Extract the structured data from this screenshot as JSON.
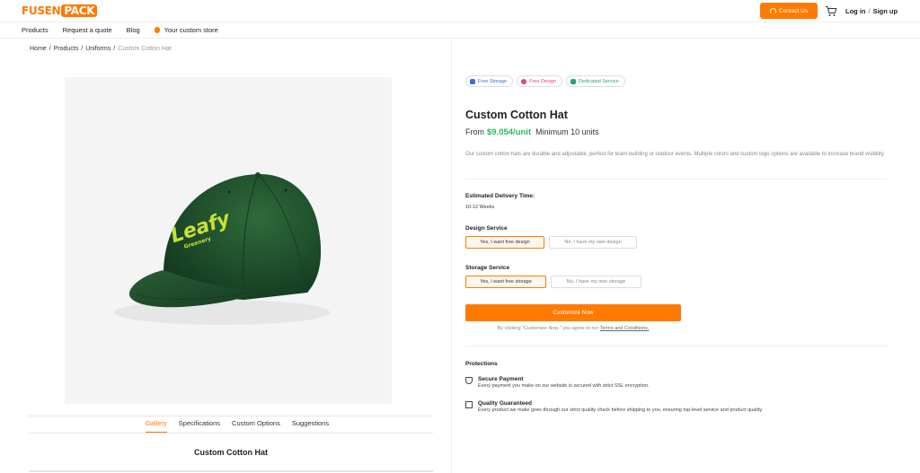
{
  "header": {
    "logo_left": "FUSEN",
    "logo_right": "PACK",
    "contact_label": "Contact Us",
    "login_label": "Log in",
    "separator": "/",
    "signup_label": "Sign up"
  },
  "nav": {
    "items": [
      "Products",
      "Request a quote",
      "Blog"
    ],
    "store_label": "Your custom store"
  },
  "breadcrumb": [
    "Home",
    "Products",
    "Uniforms",
    "Custom Cotton Hat"
  ],
  "product_image": {
    "logo_text": "Leafy",
    "logo_subtext": "Greenery"
  },
  "gallery_tabs": [
    "Gallery",
    "Specifications",
    "Custom Options",
    "Suggestions"
  ],
  "bottom_title": "Custom Cotton Hat",
  "badges": [
    "Free Storage",
    "Free Design",
    "Dedicated Service"
  ],
  "product": {
    "title": "Custom Cotton Hat",
    "price_prefix": "From",
    "price": "$9.054/unit",
    "minimum": "Minimum 10 units",
    "description": "Our custom cotton hats are durable and adjustable, perfect for team-building or outdoor events. Multiple colors and custom logo options are available to increase brand visibility."
  },
  "delivery": {
    "label": "Estimated Delivery Time:",
    "value": "10-12 Weeks"
  },
  "design_service": {
    "label": "Design Service",
    "options": [
      "Yes, I want free design",
      "No, I have my own design"
    ],
    "selected": 0
  },
  "storage_service": {
    "label": "Storage Service",
    "options": [
      "Yes, I want free storage",
      "No, I have my own storage"
    ],
    "selected": 0
  },
  "cta": {
    "label": "Customize Now",
    "agree_text": "By clicking \"Customize Now,\" you agree to our",
    "terms_link": "Terms and Conditions."
  },
  "protections": {
    "heading": "Protections",
    "items": [
      {
        "title": "Secure Payment",
        "text": "Every payment you make on our website is secured with strict SSL encryption."
      },
      {
        "title": "Quality Guaranteed",
        "text": "Every product we make goes through our strict quality check before shipping to you, ensuring top-level service and product quality."
      }
    ]
  },
  "colors": {
    "brand_orange": "#ff7a00",
    "price_green": "#2eb85c",
    "hat_green": "#1f4d2b",
    "logo_yellow": "#c8e03a"
  }
}
